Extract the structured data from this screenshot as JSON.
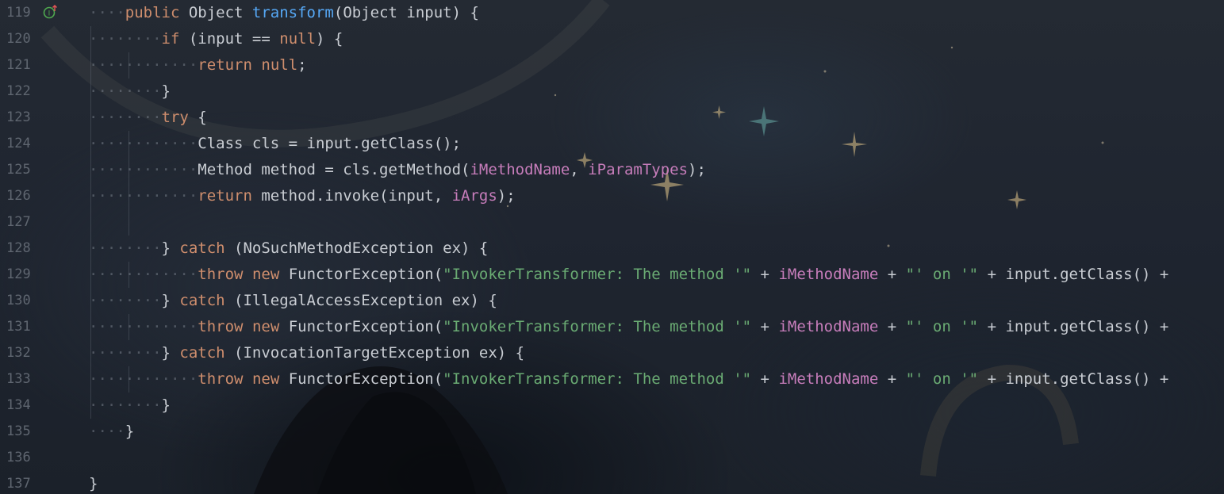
{
  "editor": {
    "gutter_icon": "implements-interface-override-icon",
    "lines": [
      {
        "num": "119",
        "indent": 1,
        "tokens": [
          {
            "t": "public",
            "c": "kw"
          },
          {
            "t": " Object ",
            "c": "plain"
          },
          {
            "t": "transform",
            "c": "fn"
          },
          {
            "t": "(Object input) {",
            "c": "plain"
          }
        ]
      },
      {
        "num": "120",
        "indent": 2,
        "tokens": [
          {
            "t": "if",
            "c": "kw"
          },
          {
            "t": " (input == ",
            "c": "plain"
          },
          {
            "t": "null",
            "c": "kw"
          },
          {
            "t": ") {",
            "c": "plain"
          }
        ]
      },
      {
        "num": "121",
        "indent": 3,
        "tokens": [
          {
            "t": "return",
            "c": "kw"
          },
          {
            "t": " ",
            "c": "plain"
          },
          {
            "t": "null",
            "c": "kw"
          },
          {
            "t": ";",
            "c": "plain"
          }
        ]
      },
      {
        "num": "122",
        "indent": 2,
        "tokens": [
          {
            "t": "}",
            "c": "plain"
          }
        ]
      },
      {
        "num": "123",
        "indent": 2,
        "tokens": [
          {
            "t": "try",
            "c": "kw"
          },
          {
            "t": " {",
            "c": "plain"
          }
        ]
      },
      {
        "num": "124",
        "indent": 3,
        "tokens": [
          {
            "t": "Class cls = input.getClass();",
            "c": "plain"
          }
        ]
      },
      {
        "num": "125",
        "indent": 3,
        "tokens": [
          {
            "t": "Method method = cls.getMethod(",
            "c": "plain"
          },
          {
            "t": "iMethodName",
            "c": "field"
          },
          {
            "t": ", ",
            "c": "plain"
          },
          {
            "t": "iParamTypes",
            "c": "field"
          },
          {
            "t": ");",
            "c": "plain"
          }
        ]
      },
      {
        "num": "126",
        "indent": 3,
        "tokens": [
          {
            "t": "return",
            "c": "kw"
          },
          {
            "t": " method.invoke(input, ",
            "c": "plain"
          },
          {
            "t": "iArgs",
            "c": "field"
          },
          {
            "t": ");",
            "c": "plain"
          }
        ]
      },
      {
        "num": "127",
        "indent": 0,
        "tokens": []
      },
      {
        "num": "128",
        "indent": 2,
        "tokens": [
          {
            "t": "} ",
            "c": "plain"
          },
          {
            "t": "catch",
            "c": "kw"
          },
          {
            "t": " (NoSuchMethodException ex) {",
            "c": "plain"
          }
        ]
      },
      {
        "num": "129",
        "indent": 3,
        "tokens": [
          {
            "t": "throw",
            "c": "kw"
          },
          {
            "t": " ",
            "c": "plain"
          },
          {
            "t": "new",
            "c": "kw"
          },
          {
            "t": " FunctorException(",
            "c": "plain"
          },
          {
            "t": "\"InvokerTransformer: The method '\"",
            "c": "str"
          },
          {
            "t": " + ",
            "c": "plain"
          },
          {
            "t": "iMethodName",
            "c": "field"
          },
          {
            "t": " + ",
            "c": "plain"
          },
          {
            "t": "\"' on '\"",
            "c": "str"
          },
          {
            "t": " + input.getClass() +",
            "c": "plain"
          }
        ]
      },
      {
        "num": "130",
        "indent": 2,
        "tokens": [
          {
            "t": "} ",
            "c": "plain"
          },
          {
            "t": "catch",
            "c": "kw"
          },
          {
            "t": " (IllegalAccessException ex) {",
            "c": "plain"
          }
        ]
      },
      {
        "num": "131",
        "indent": 3,
        "tokens": [
          {
            "t": "throw",
            "c": "kw"
          },
          {
            "t": " ",
            "c": "plain"
          },
          {
            "t": "new",
            "c": "kw"
          },
          {
            "t": " FunctorException(",
            "c": "plain"
          },
          {
            "t": "\"InvokerTransformer: The method '\"",
            "c": "str"
          },
          {
            "t": " + ",
            "c": "plain"
          },
          {
            "t": "iMethodName",
            "c": "field"
          },
          {
            "t": " + ",
            "c": "plain"
          },
          {
            "t": "\"' on '\"",
            "c": "str"
          },
          {
            "t": " + input.getClass() +",
            "c": "plain"
          }
        ]
      },
      {
        "num": "132",
        "indent": 2,
        "tokens": [
          {
            "t": "} ",
            "c": "plain"
          },
          {
            "t": "catch",
            "c": "kw"
          },
          {
            "t": " (InvocationTargetException ex) {",
            "c": "plain"
          }
        ]
      },
      {
        "num": "133",
        "indent": 3,
        "tokens": [
          {
            "t": "throw",
            "c": "kw"
          },
          {
            "t": " ",
            "c": "plain"
          },
          {
            "t": "new",
            "c": "kw"
          },
          {
            "t": " FunctorException(",
            "c": "plain"
          },
          {
            "t": "\"InvokerTransformer: The method '\"",
            "c": "str"
          },
          {
            "t": " + ",
            "c": "plain"
          },
          {
            "t": "iMethodName",
            "c": "field"
          },
          {
            "t": " + ",
            "c": "plain"
          },
          {
            "t": "\"' on '\"",
            "c": "str"
          },
          {
            "t": " + input.getClass() +",
            "c": "plain"
          }
        ]
      },
      {
        "num": "134",
        "indent": 2,
        "tokens": [
          {
            "t": "}",
            "c": "plain"
          }
        ]
      },
      {
        "num": "135",
        "indent": 1,
        "tokens": [
          {
            "t": "}",
            "c": "plain"
          }
        ]
      },
      {
        "num": "136",
        "indent": 0,
        "tokens": []
      },
      {
        "num": "137",
        "indent": 0,
        "tokens": [
          {
            "t": "}",
            "c": "plain"
          }
        ]
      }
    ]
  },
  "colors": {
    "keyword": "#cf8e6d",
    "method_declaration": "#56a8f5",
    "field": "#c77dbb",
    "string": "#6aab73",
    "default_text": "#c9cdd3",
    "line_number": "#5f6670"
  }
}
